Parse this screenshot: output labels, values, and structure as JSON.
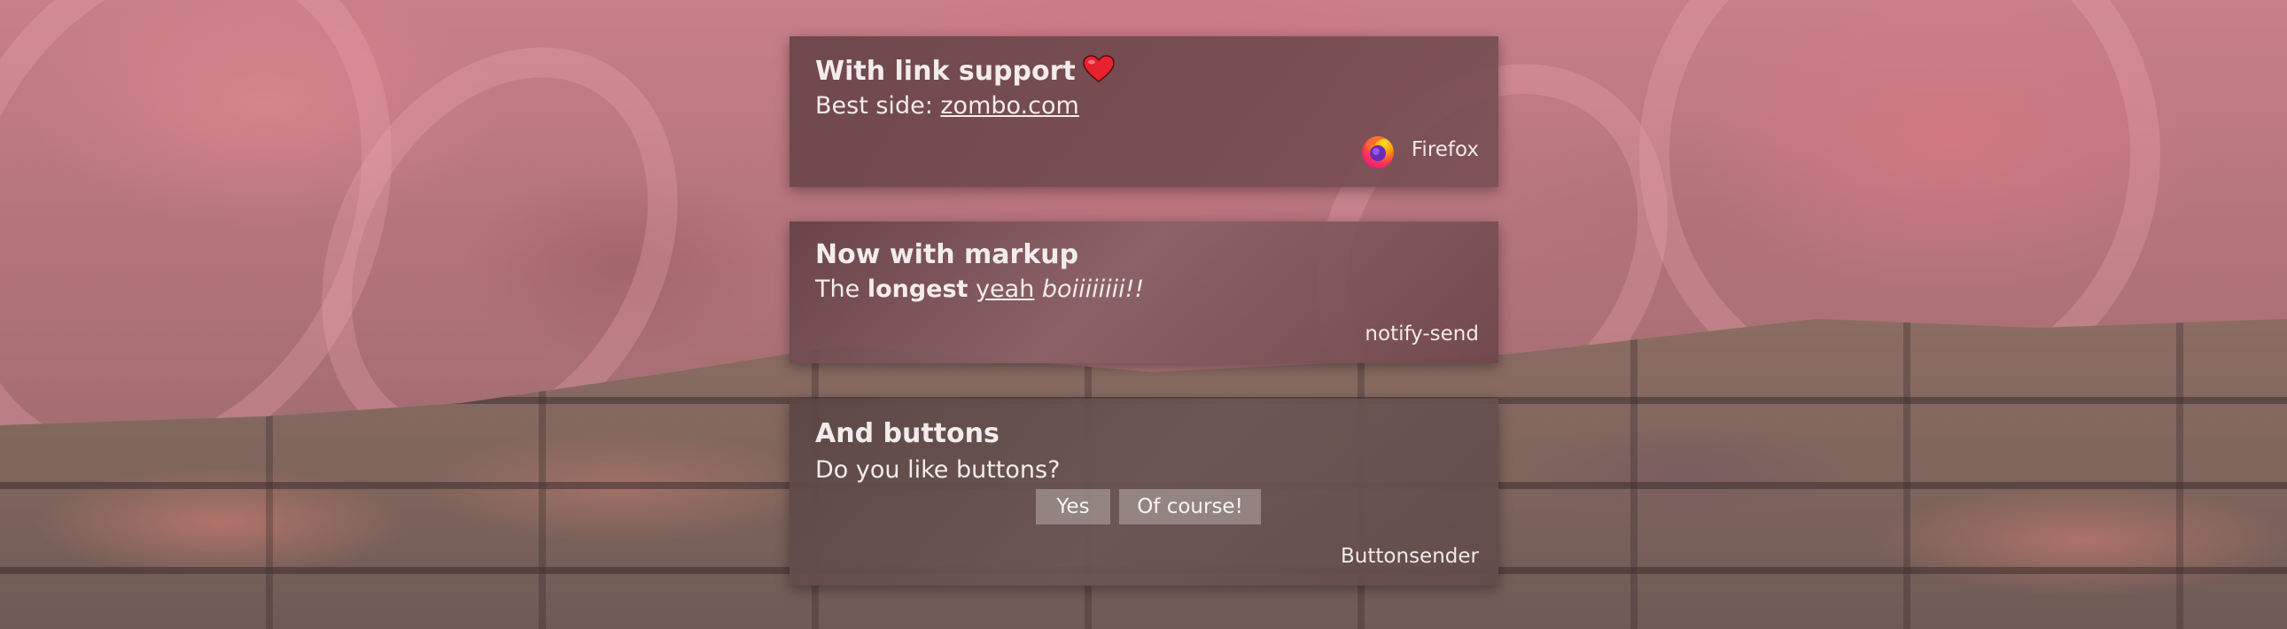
{
  "notifications": [
    {
      "summary": "With link support",
      "summary_icon": "heart-icon",
      "body_prefix": "Best side: ",
      "body_link": "zombo.com",
      "app_name": "Firefox",
      "app_icon": "firefox-icon"
    },
    {
      "summary": "Now with markup",
      "body_parts": {
        "p1": "The ",
        "bold": "longest",
        "p2": " ",
        "underline": "yeah",
        "p3": " ",
        "italic": "boiiiiiiii!!"
      },
      "app_name": "notify-send"
    },
    {
      "summary": "And buttons",
      "body": "Do you like buttons?",
      "buttons": [
        "Yes",
        "Of course!"
      ],
      "app_name": "Buttonsender"
    }
  ],
  "colors": {
    "notification_text": "#f3ecec",
    "heart": "#e8212e",
    "button_bg": "#c8bebc"
  }
}
